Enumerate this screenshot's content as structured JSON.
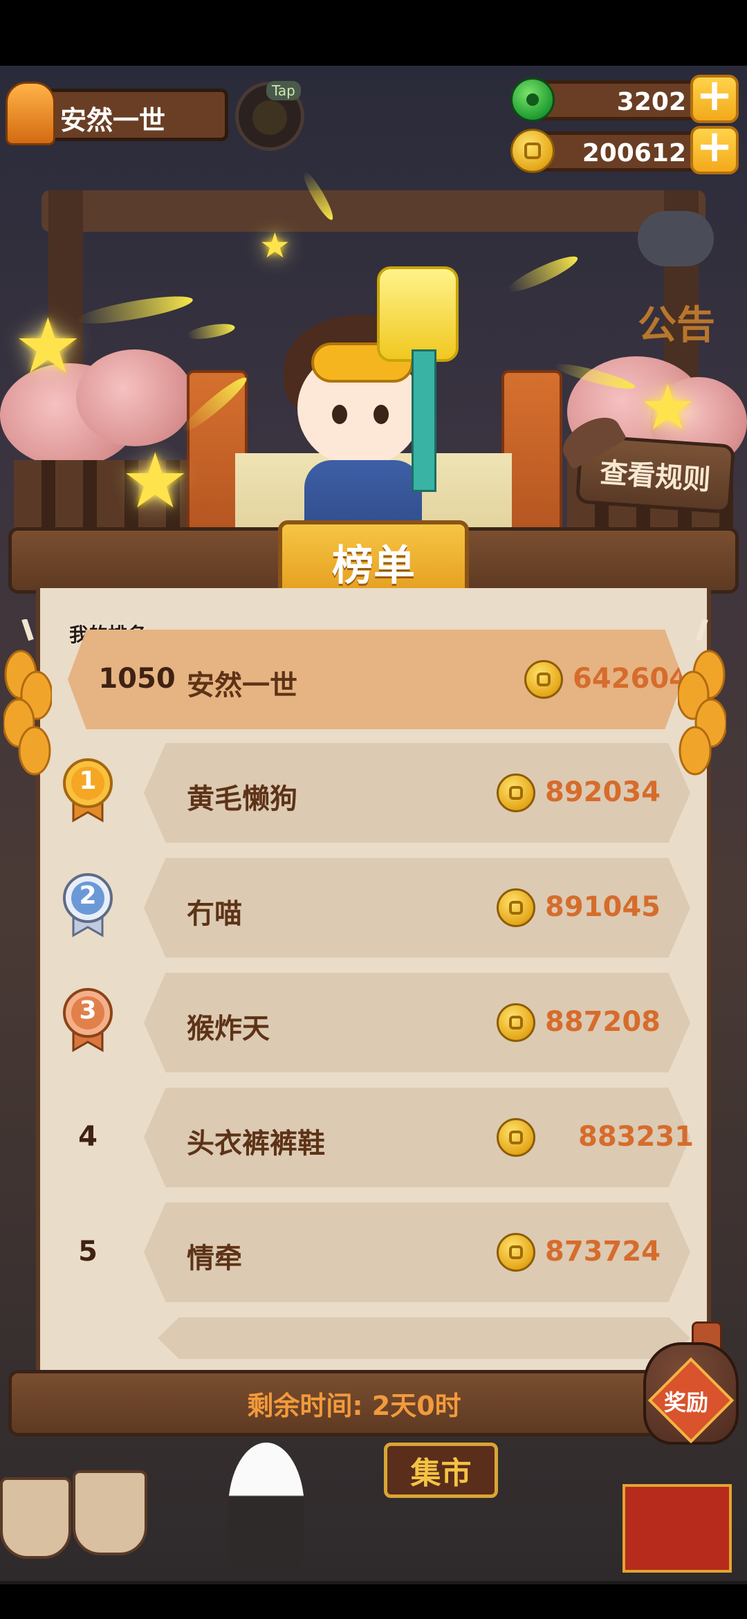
{
  "player": {
    "name": "安然一世"
  },
  "tap_label": "Tap",
  "currencies": [
    {
      "icon": "jade-coin-icon",
      "value": "3202"
    },
    {
      "icon": "gold-coin-icon",
      "value": "200612"
    }
  ],
  "notice_label": "公告",
  "rules_button": "查看规则",
  "leaderboard": {
    "title": "榜单",
    "my_rank_label": "我的排名",
    "me": {
      "rank": "1050",
      "name": "安然一世",
      "score": "642604"
    },
    "entries": [
      {
        "rank": "1",
        "name": "黄毛懒狗",
        "score": "892034",
        "medal": "gold"
      },
      {
        "rank": "2",
        "name": "冇喵",
        "score": "891045",
        "medal": "silver"
      },
      {
        "rank": "3",
        "name": "猴炸天",
        "score": "887208",
        "medal": "bronze"
      },
      {
        "rank": "4",
        "name": "头衣裤裤鞋",
        "score": "883231"
      },
      {
        "rank": "5",
        "name": "情牵",
        "score": "873724"
      }
    ],
    "remaining_time": "剩余时间: 2天0时"
  },
  "reward_button": "奖励",
  "market_sign": "集市",
  "colors": {
    "score": "#d66c2c",
    "board": "#e9dcc8",
    "wood": "#6a3e24",
    "gold": "#f2b52a"
  }
}
